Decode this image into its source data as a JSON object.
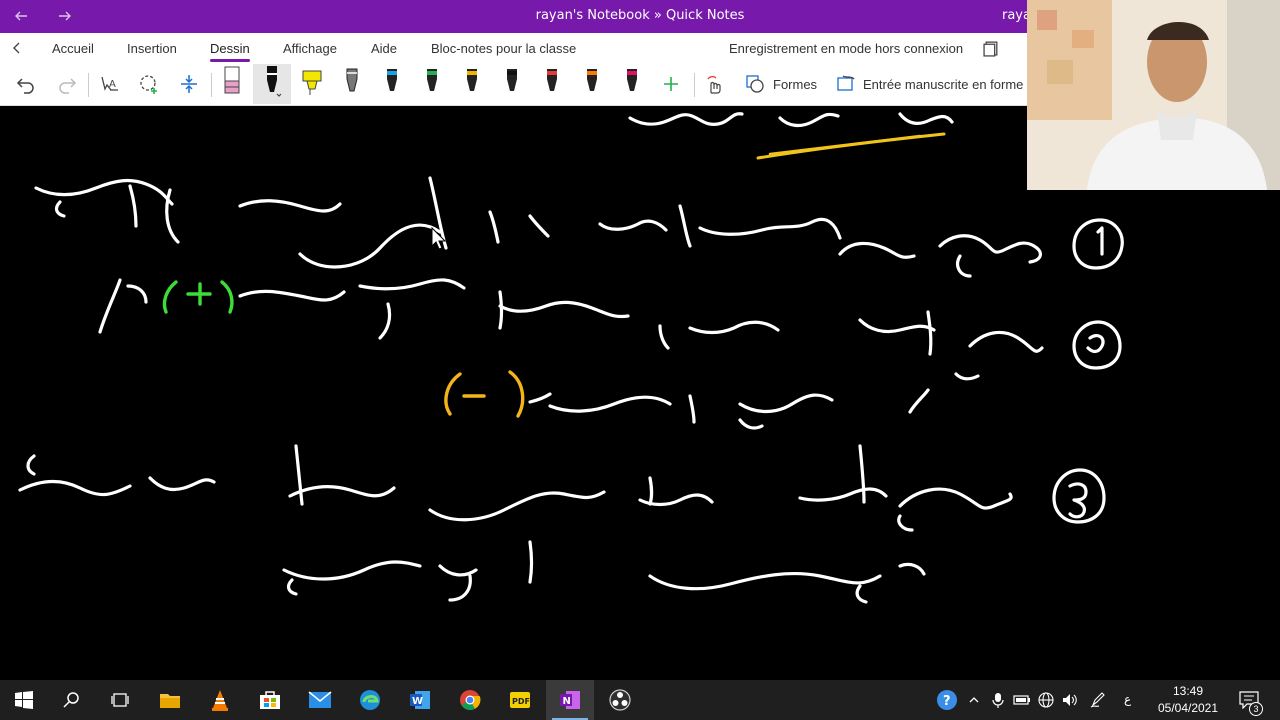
{
  "titlebar": {
    "title": "rayan's Notebook » Quick Notes",
    "user": "rayan"
  },
  "ribbon": {
    "tabs": [
      {
        "label": "Accueil"
      },
      {
        "label": "Insertion"
      },
      {
        "label": "Dessin",
        "active": true
      },
      {
        "label": "Affichage"
      },
      {
        "label": "Aide"
      },
      {
        "label": "Bloc-notes pour la classe"
      }
    ],
    "offline_status": "Enregistrement en mode hors connexion"
  },
  "toolbar": {
    "shapes_label": "Formes",
    "ink_to_shape_label": "Entrée manuscrite en forme",
    "pen_colors": [
      "#e8a0c8",
      "#111111",
      "#f3e600",
      "#777777",
      "#1aa3e6",
      "#22b14c",
      "#f0b400",
      "#111111",
      "#e53935",
      "#ff7a00",
      "#e0115f"
    ]
  },
  "taskbar": {
    "time": "13:49",
    "date": "05/04/2021",
    "language": "ع",
    "notification_count": "3"
  },
  "colors": {
    "accent": "#7719aa",
    "ink_white": "#ffffff",
    "ink_green": "#3ddc36",
    "ink_orange": "#f4b41a",
    "ink_yellow": "#f2c318"
  }
}
